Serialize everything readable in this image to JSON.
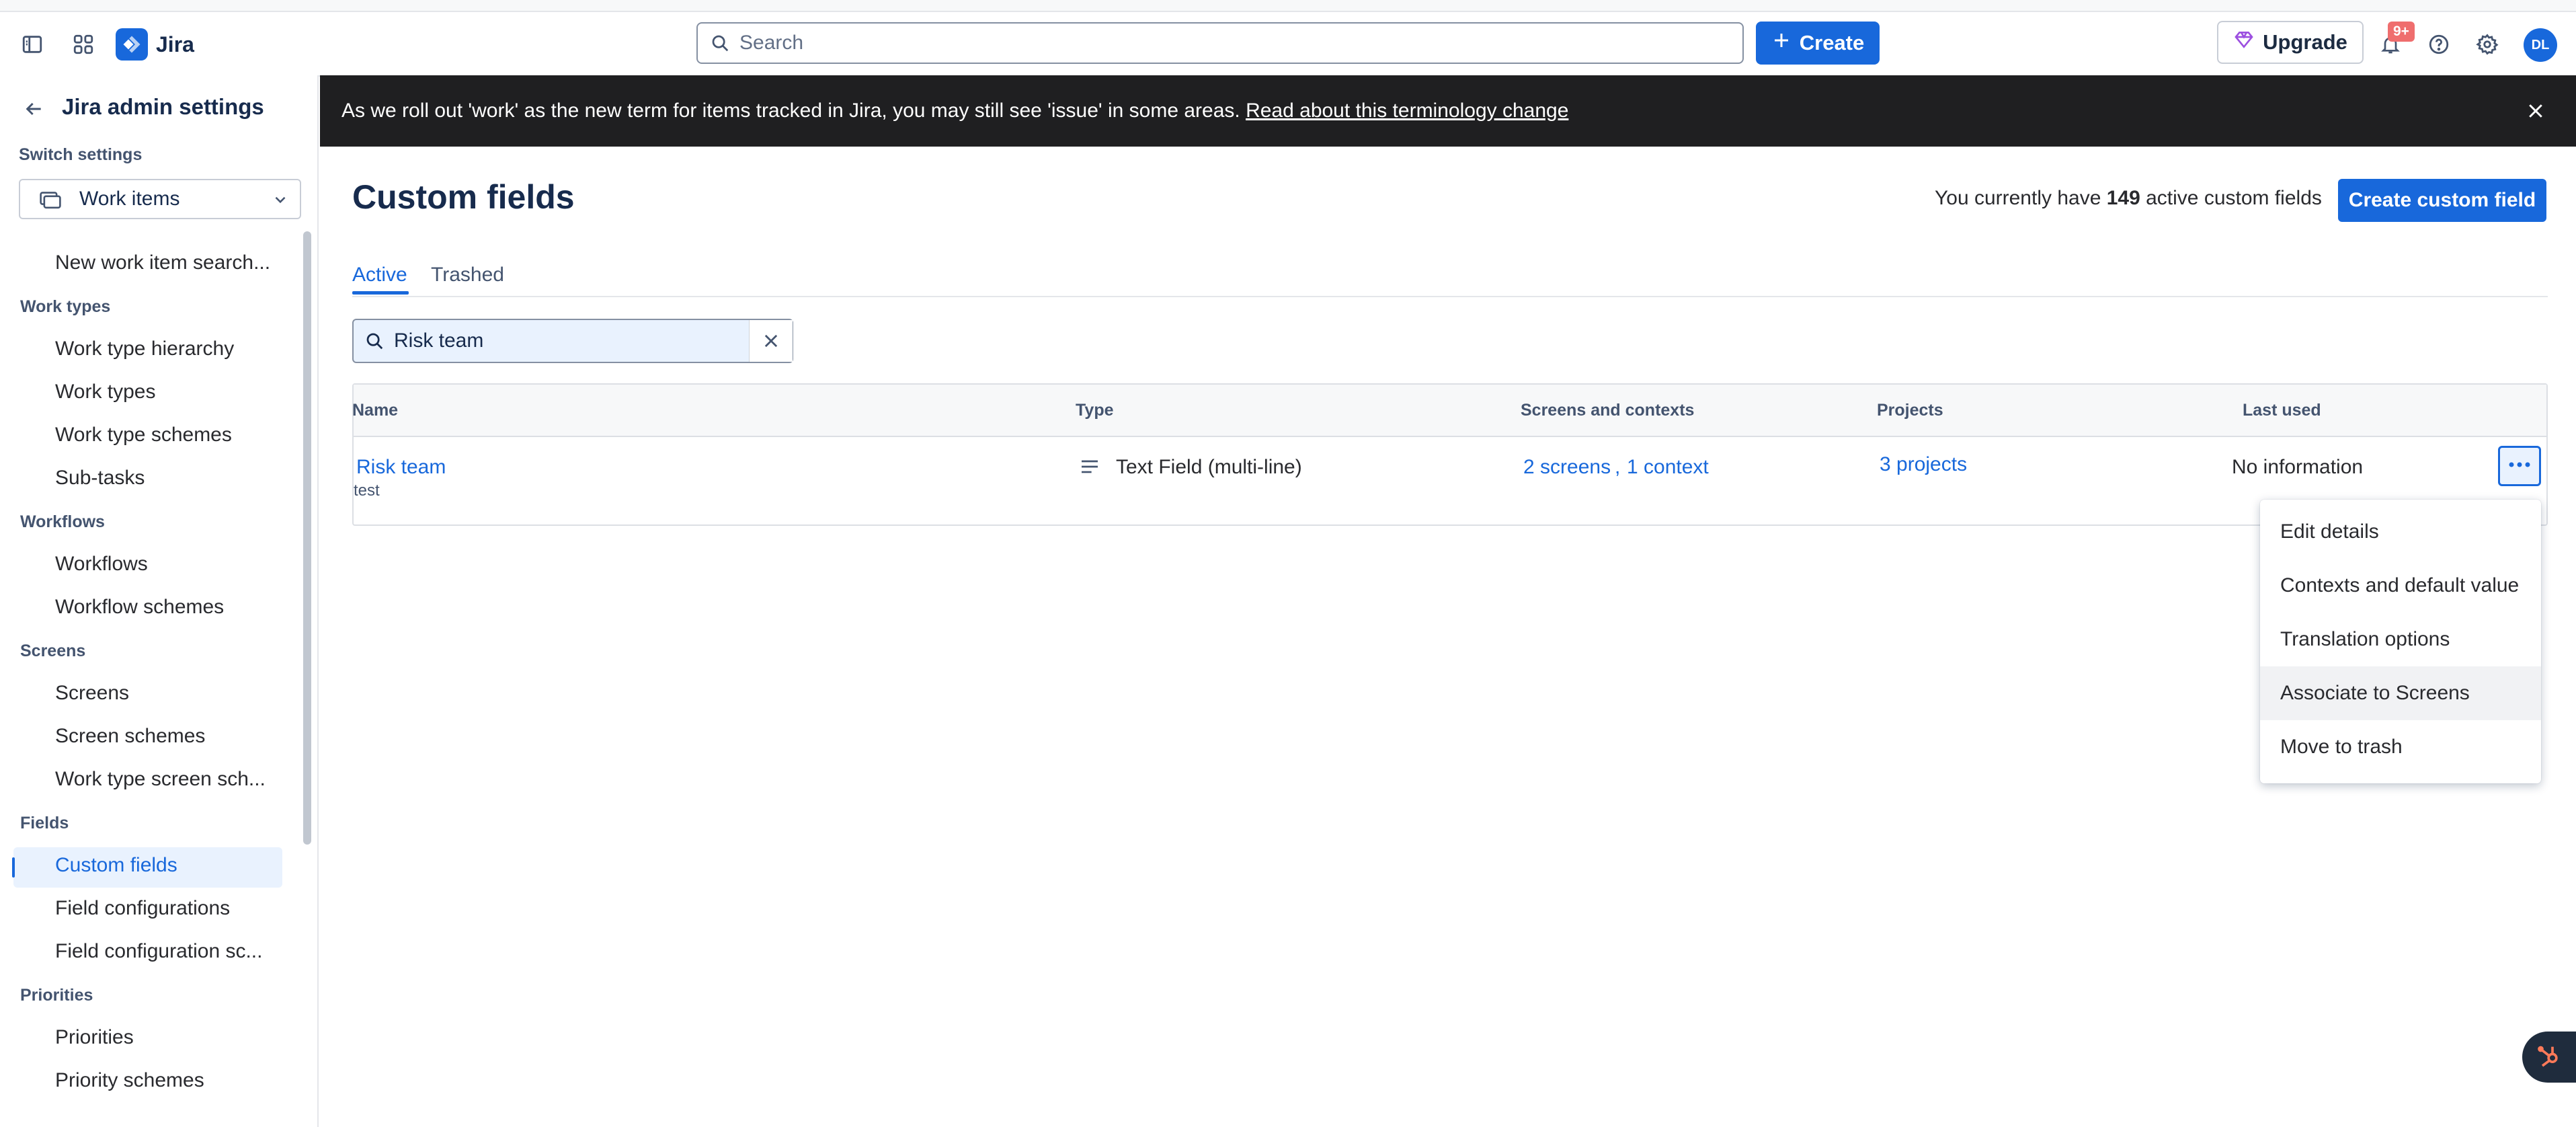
{
  "topnav": {
    "brand": "Jira",
    "search_placeholder": "Search",
    "create_label": "Create",
    "upgrade_label": "Upgrade",
    "notifications_badge": "9+",
    "avatar_initials": "DL"
  },
  "sidebar": {
    "title": "Jira admin settings",
    "switch_label": "Switch settings",
    "switch_value": "Work items",
    "items": {
      "new_search": "New work item search...",
      "head_work_types": "Work types",
      "work_type_hierarchy": "Work type hierarchy",
      "work_types": "Work types",
      "work_type_schemes": "Work type schemes",
      "sub_tasks": "Sub-tasks",
      "head_workflows": "Workflows",
      "workflows": "Workflows",
      "workflow_schemes": "Workflow schemes",
      "head_screens": "Screens",
      "screens": "Screens",
      "screen_schemes": "Screen schemes",
      "work_type_screen_schemes": "Work type screen sch...",
      "head_fields": "Fields",
      "custom_fields": "Custom fields",
      "field_configurations": "Field configurations",
      "field_configuration_schemes": "Field configuration sc...",
      "head_priorities": "Priorities",
      "priorities": "Priorities",
      "priority_schemes": "Priority schemes"
    }
  },
  "banner": {
    "text": "As we roll out 'work' as the new term for items tracked in Jira, you may still see 'issue' in some areas. ",
    "link": "Read about this terminology change"
  },
  "main": {
    "title": "Custom fields",
    "count_prefix": "You currently have ",
    "count": "149",
    "count_suffix": " active custom fields",
    "create_button": "Create custom field",
    "tabs": [
      "Active",
      "Trashed"
    ],
    "filter_value": "Risk team"
  },
  "table": {
    "headers": [
      "Name",
      "Type",
      "Screens and contexts",
      "Projects",
      "Last used"
    ],
    "row": {
      "name": "Risk team",
      "description": "test",
      "type": "Text Field (multi-line)",
      "screens": "2 screens",
      "contexts": "1 context",
      "projects": "3 projects",
      "last_used": "No information"
    }
  },
  "menu": {
    "items": [
      "Edit details",
      "Contexts and default value",
      "Translation options",
      "Associate to Screens",
      "Move to trash"
    ],
    "highlighted": "Associate to Screens"
  },
  "colors": {
    "accent": "#1868db",
    "banner": "#1f1f21",
    "badge": "#ef6e6e",
    "selected_bg": "#e9f2fe"
  }
}
